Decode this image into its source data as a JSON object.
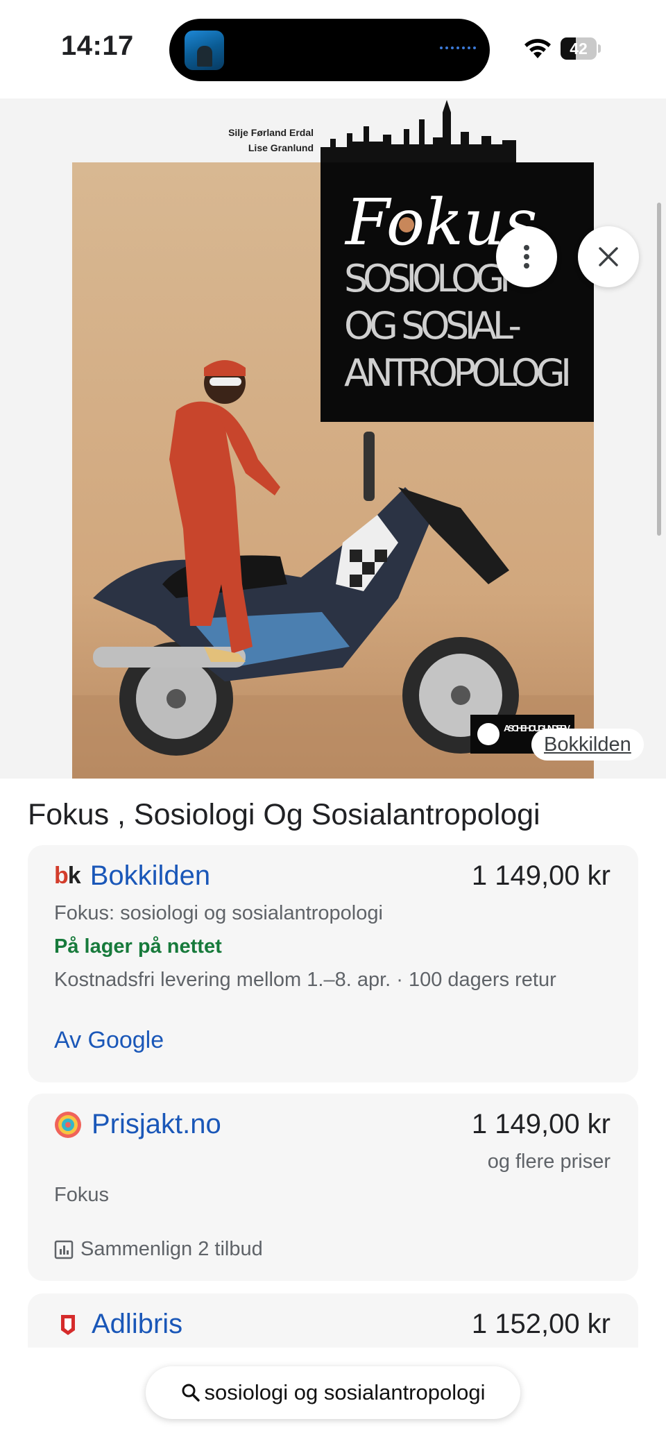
{
  "status_bar": {
    "time": "14:17",
    "battery_level": "42",
    "battery_fraction": 0.42
  },
  "image": {
    "author_line_1": "Silje Førland Erdal",
    "author_line_2": "Lise Granlund",
    "cover_title": "Fokus",
    "cover_subtitle_1": "SOSIOLOGI",
    "cover_subtitle_2": "OG SOSIAL-",
    "cover_subtitle_3": "ANTROPOLOGI",
    "publisher_badge": "ASCHEHOUG UNDERV",
    "source_label": "Bokkilden",
    "icons": {
      "more": "more-vertical-icon",
      "close": "close-icon"
    }
  },
  "product": {
    "title": "Fokus , Sosiologi Og Sosialantropologi"
  },
  "offers": [
    {
      "merchant": "Bokkilden",
      "logo_text": "bk",
      "price": "1 149,00 kr",
      "description": "Fokus: sosiologi og sosialantropologi",
      "stock": "På lager på nettet",
      "delivery": "Kostnadsfri levering mellom 1.–8. apr. · 100 dagers retur",
      "link": "Av Google"
    },
    {
      "merchant": "Prisjakt.no",
      "price": "1 149,00 kr",
      "more_prices": "og flere priser",
      "description": "Fokus",
      "compare": "Sammenlign 2 tilbud"
    },
    {
      "merchant": "Adlibris",
      "price": "1 152,00 kr"
    }
  ],
  "search": {
    "query": "sosiologi og sosialantropologi",
    "icon": "search-icon"
  },
  "colors": {
    "link_blue": "#1a57b8",
    "stock_green": "#177a3b",
    "card_bg": "#f6f6f6"
  }
}
